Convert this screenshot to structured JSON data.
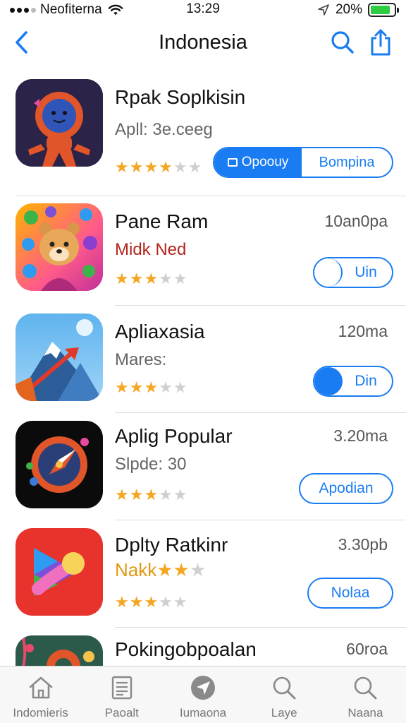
{
  "status_bar": {
    "carrier": "Neofiterna",
    "time": "13:29",
    "battery": "20%",
    "battery_level": 0.85
  },
  "nav": {
    "title": "Indonesia",
    "accent": "#1a7cf2"
  },
  "apps": [
    {
      "name": "Rpak Soplkisin",
      "subtitle": "Apll: 3e.ceeg",
      "rating": 4,
      "segment": {
        "left_label": "Opoouy",
        "right_label": "Bompina"
      }
    },
    {
      "name": "Pane Ram",
      "subtitle": "Midk Ned",
      "size": "10an0pa",
      "rating": 3,
      "button": "Uin"
    },
    {
      "name": "Apliaxasia",
      "subtitle": "Mares:",
      "size": "120ma",
      "rating": 3,
      "button": "Din"
    },
    {
      "name": "Aplig Popular",
      "subtitle": "Slpde: 30",
      "size": "3.20ma",
      "rating": 3,
      "button": "Apodian"
    },
    {
      "name": "Dplty Ratkinr",
      "subtitle": "Nakk",
      "size": "3.30pb",
      "rating": 3,
      "button": "Nolaa"
    },
    {
      "name": "Pokingobpoalan",
      "size": "60roa"
    }
  ],
  "tabs": [
    {
      "label": "Indomieris",
      "icon": "home-icon"
    },
    {
      "label": "Paoalt",
      "icon": "list-icon"
    },
    {
      "label": "Iumaona",
      "icon": "navigation-icon"
    },
    {
      "label": "Laye",
      "icon": "search-icon"
    },
    {
      "label": "Naana",
      "icon": "search-icon"
    }
  ]
}
